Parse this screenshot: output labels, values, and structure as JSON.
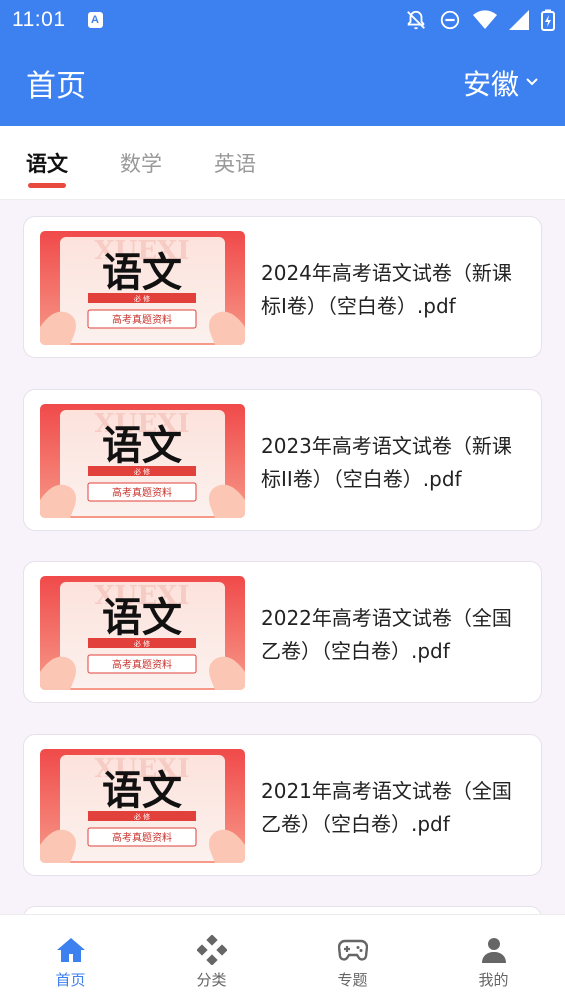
{
  "status_bar": {
    "time": "11:01",
    "badge": "A"
  },
  "header": {
    "title": "首页",
    "region": "安徽"
  },
  "tabs": [
    {
      "label": "语文",
      "active": true
    },
    {
      "label": "数学",
      "active": false
    },
    {
      "label": "英语",
      "active": false
    }
  ],
  "thumbnail": {
    "subject": "语文",
    "ribbon": "必 修",
    "caption": "高考真题资料",
    "watermark": "XUEXI"
  },
  "documents": [
    {
      "title": "2024年高考语文试卷（新课标I卷）（空白卷）.pdf"
    },
    {
      "title": "2023年高考语文试卷（新课标II卷）（空白卷）.pdf"
    },
    {
      "title": "2022年高考语文试卷（全国乙卷）（空白卷）.pdf"
    },
    {
      "title": "2021年高考语文试卷（全国乙卷）（空白卷）.pdf"
    }
  ],
  "bottom_nav": [
    {
      "label": "首页",
      "icon": "home-icon",
      "active": true
    },
    {
      "label": "分类",
      "icon": "category-icon",
      "active": false
    },
    {
      "label": "专题",
      "icon": "gamepad-icon",
      "active": false
    },
    {
      "label": "我的",
      "icon": "person-icon",
      "active": false
    }
  ],
  "colors": {
    "primary": "#3d80f0",
    "accent": "#e84a3e",
    "background": "#f8f3fa"
  }
}
